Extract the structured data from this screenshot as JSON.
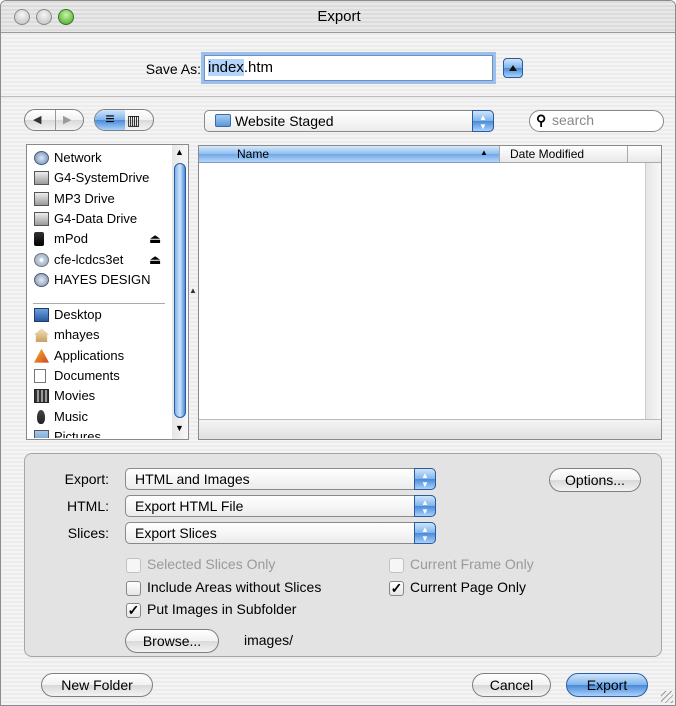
{
  "window": {
    "title": "Export"
  },
  "save_as": {
    "label": "Save As:",
    "value": "index.htm"
  },
  "toolbar": {
    "back_glyph": "◀",
    "forward_glyph": "▶",
    "list_view_glyph": "≡",
    "column_view_glyph": "▥",
    "location": "Website Staged",
    "search_placeholder": "search"
  },
  "sidebar": {
    "devices": [
      {
        "label": "Network",
        "icon": "network-icon"
      },
      {
        "label": "G4-SystemDrive",
        "icon": "hard-drive-icon"
      },
      {
        "label": "MP3 Drive",
        "icon": "hard-drive-icon"
      },
      {
        "label": "G4-Data Drive",
        "icon": "hard-drive-icon"
      },
      {
        "label": "mPod",
        "icon": "ipod-icon",
        "eject": "⏏"
      },
      {
        "label": "cfe-lcdcs3et",
        "icon": "cd-icon",
        "eject": "⏏"
      },
      {
        "label": "HAYES DESIGN",
        "icon": "network-drive-icon"
      }
    ],
    "places": [
      {
        "label": "Desktop",
        "icon": "desktop-icon"
      },
      {
        "label": "mhayes",
        "icon": "home-icon"
      },
      {
        "label": "Applications",
        "icon": "applications-icon"
      },
      {
        "label": "Documents",
        "icon": "documents-icon"
      },
      {
        "label": "Movies",
        "icon": "movies-icon"
      },
      {
        "label": "Music",
        "icon": "music-icon"
      },
      {
        "label": "Pictures",
        "icon": "pictures-icon"
      }
    ]
  },
  "file_list": {
    "columns": [
      "Name",
      "Date Modified"
    ],
    "rows": []
  },
  "options": {
    "export_label": "Export:",
    "export_value": "HTML and Images",
    "html_label": "HTML:",
    "html_value": "Export HTML File",
    "slices_label": "Slices:",
    "slices_value": "Export Slices",
    "options_button": "Options...",
    "selected_slices_only": "Selected Slices Only",
    "current_frame_only": "Current Frame Only",
    "include_areas": "Include Areas without Slices",
    "current_page_only": "Current Page Only",
    "put_images": "Put Images in Subfolder",
    "browse_button": "Browse...",
    "folder": "images/",
    "checks": {
      "selected_slices_only": false,
      "current_frame_only": false,
      "include_areas": false,
      "current_page_only": true,
      "put_images": true
    },
    "check_glyph": "✓"
  },
  "footer": {
    "new_folder": "New Folder",
    "cancel": "Cancel",
    "export": "Export"
  },
  "colors": {
    "accent": "#4a8ad8",
    "header_blue": "#6ea6e6"
  }
}
